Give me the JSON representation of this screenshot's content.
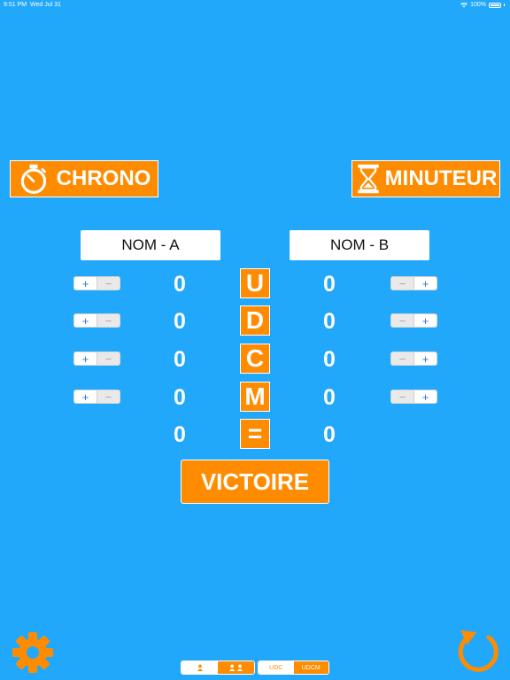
{
  "status_bar": {
    "time": "9:51 PM",
    "date": "Wed Jul 31",
    "battery": "100%"
  },
  "top_buttons": {
    "chrono_label": "CHRONO",
    "minuteur_label": "MINUTEUR"
  },
  "teams": {
    "a_name": "NOM - A",
    "b_name": "NOM - B"
  },
  "rows": [
    {
      "letter": "U",
      "score_a": "0",
      "score_b": "0"
    },
    {
      "letter": "D",
      "score_a": "0",
      "score_b": "0"
    },
    {
      "letter": "C",
      "score_a": "0",
      "score_b": "0"
    },
    {
      "letter": "M",
      "score_a": "0",
      "score_b": "0"
    },
    {
      "letter": "=",
      "score_a": "0",
      "score_b": "0"
    }
  ],
  "stepper": {
    "plus": "+",
    "minus": "−"
  },
  "victoire_label": "VICTOIRE",
  "mode_segment": {
    "udc": "UDC",
    "udcm": "UDCM",
    "selected": "UDCM"
  },
  "players_segment": {
    "selected": "two-players"
  },
  "colors": {
    "background": "#22a8fb",
    "accent": "#ff8c00",
    "plus": "#2a74d9"
  },
  "icons": [
    "stopwatch-icon",
    "hourglass-icon",
    "gear-icon",
    "reset-icon",
    "single-player-icon",
    "two-players-icon",
    "wifi-icon",
    "battery-icon"
  ]
}
